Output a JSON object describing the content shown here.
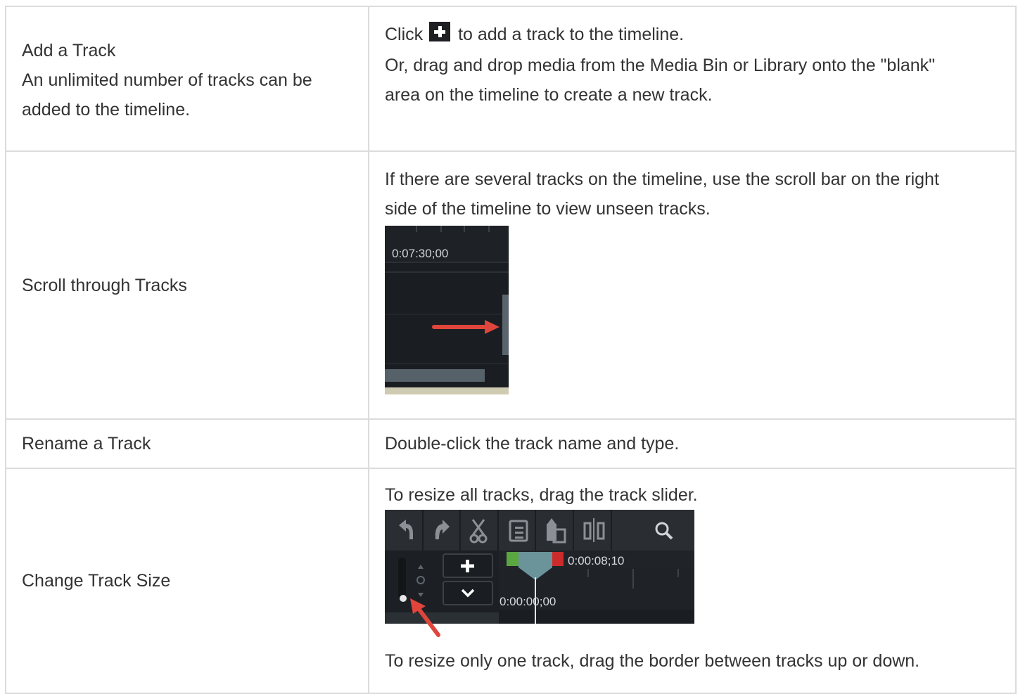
{
  "rows": [
    {
      "label_lines": [
        "Add a Track",
        "An unlimited number of tracks can be",
        "added to the timeline."
      ],
      "desc_lines": [
        "to add a track to the timeline.",
        "Or, drag and drop media from the Media Bin or Library onto the \"blank\"",
        "area on the timeline to create a new track."
      ],
      "click_word": "Click",
      "icon": "add-track-plus-icon"
    },
    {
      "label": "Scroll through Tracks",
      "desc_lines": [
        "If there are several tracks on the timeline, use the scroll bar on the right",
        "side of the timeline to view unseen tracks."
      ],
      "screenshot": {
        "timecode": "0:07:30;00"
      }
    },
    {
      "label": "Rename a Track",
      "desc": "Double-click the track name and type."
    },
    {
      "label": "Change Track Size",
      "desc_top": "To resize all tracks, drag the track slider.",
      "desc_bottom": "To resize only one track, drag the border between tracks up or down.",
      "screenshot": {
        "timecode_top": "0:00:08;10",
        "timecode_bottom": "0:00:00;00",
        "toolbar_icons": [
          "undo-icon",
          "redo-icon",
          "cut-icon",
          "copy-icon",
          "paste-icon",
          "split-icon",
          "zoom-icon"
        ]
      }
    }
  ],
  "colors": {
    "border": "#dcdcdc",
    "text": "#333333",
    "arrow": "#e0453b",
    "dark_ui": "#1a1e22"
  }
}
